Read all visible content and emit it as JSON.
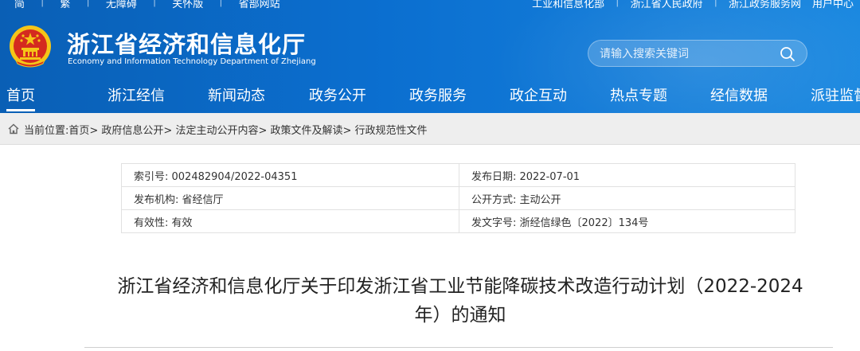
{
  "topbar": {
    "left": [
      "简",
      "繁",
      "无障碍",
      "关怀版",
      "省部网站"
    ],
    "right": [
      "工业和信息化部",
      "浙江省人民政府",
      "浙江政务服务网",
      "用户中心"
    ]
  },
  "brand": {
    "name_cn": "浙江省经济和信息化厅",
    "name_en": "Economy and Information Technology Department of Zhejiang"
  },
  "search": {
    "placeholder": "请输入搜索关键词"
  },
  "nav": {
    "items": [
      "首页",
      "浙江经信",
      "新闻动态",
      "政务公开",
      "政务服务",
      "政企互动",
      "热点专题",
      "经信数据",
      "派驻监督"
    ]
  },
  "breadcrumb": {
    "label": "当前位置:",
    "path": "首页> 政府信息公开> 法定主动公开内容> 政策文件及解读> 行政规范性文件"
  },
  "meta": {
    "index_no": "索引号: 002482904/2022-04351",
    "publish_date": "发布日期: 2022-07-01",
    "issuer": "发布机构: 省经信厅",
    "open_mode": "公开方式: 主动公开",
    "validity": "有效性: 有效",
    "doc_no": "发文字号: 浙经信绿色〔2022〕134号"
  },
  "article": {
    "title_line1": "浙江省经济和信息化厅关于印发浙江省工业节能降碳技术改造行动计划（2022-2024",
    "title_line2": "年）的通知"
  },
  "colors": {
    "header_blue": "#0b6fd0",
    "crumb_bg": "#eeeeee",
    "emblem_red": "#d42a1f",
    "emblem_gold": "#f5c518"
  }
}
